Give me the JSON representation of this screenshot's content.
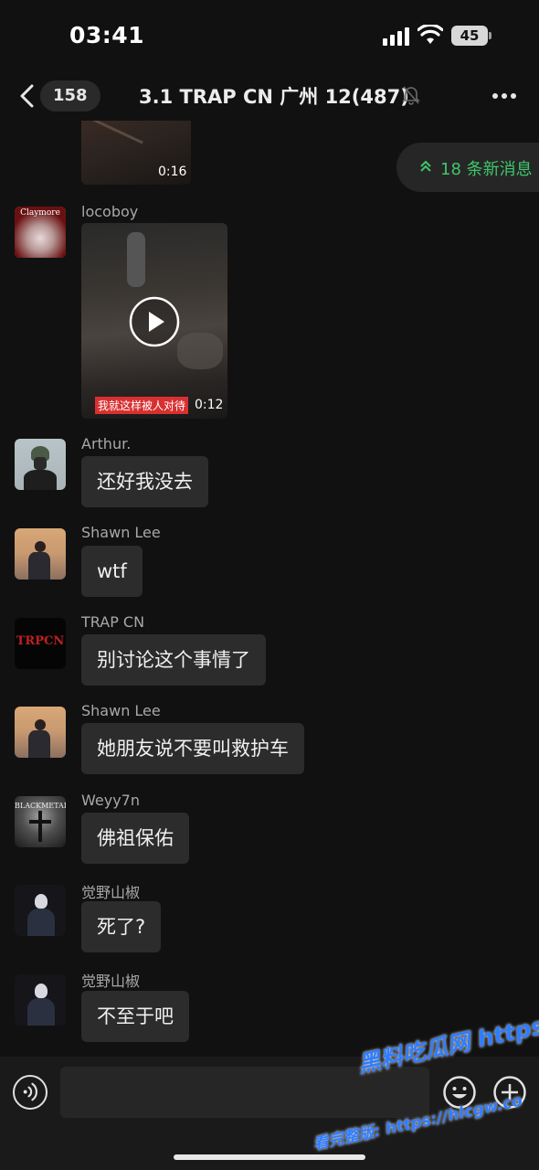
{
  "status_bar": {
    "time": "03:41",
    "battery": "45"
  },
  "nav": {
    "unread_count": "158",
    "title": "3.1 TRAP CN 广州 12(487)"
  },
  "new_messages_pill": "18 条新消息",
  "messages": [
    {
      "type": "video",
      "duration": "0:16"
    },
    {
      "type": "video",
      "sender": "locoboy",
      "duration": "0:12",
      "caption": "我就这样被人对待"
    },
    {
      "type": "text",
      "sender": "Arthur.",
      "text": "还好我没去"
    },
    {
      "type": "text",
      "sender": "Shawn Lee",
      "text": "wtf"
    },
    {
      "type": "text",
      "sender": "TRAP CN",
      "text": "别讨论这个事情了"
    },
    {
      "type": "text",
      "sender": "Shawn Lee",
      "text": "她朋友说不要叫救护车"
    },
    {
      "type": "text",
      "sender": "Weyy7n",
      "text": "佛祖保佑"
    },
    {
      "type": "text",
      "sender": "觉野山椒",
      "text": "死了?"
    },
    {
      "type": "text",
      "sender": "觉野山椒",
      "text": "不至于吧"
    }
  ],
  "avatars": {
    "locoboy": "Claymore",
    "trap_cn": "TRPCN",
    "weyy7n": "BLACKMETAL"
  },
  "watermark": {
    "line1": "黑料吃瓜网 https://hlcgw.co",
    "line2": "看完整版: https://hlcgw.co"
  },
  "colors": {
    "accent": "#3fc76a",
    "bubble": "#2c2c2c",
    "background": "#111111",
    "watermark": "#2f7dff"
  },
  "icons": [
    "signal-icon",
    "wifi-icon",
    "battery-icon",
    "back-chevron-icon",
    "mute-icon",
    "more-icon",
    "double-chevron-up-icon",
    "play-icon",
    "voice-icon",
    "emoji-icon",
    "plus-icon"
  ]
}
